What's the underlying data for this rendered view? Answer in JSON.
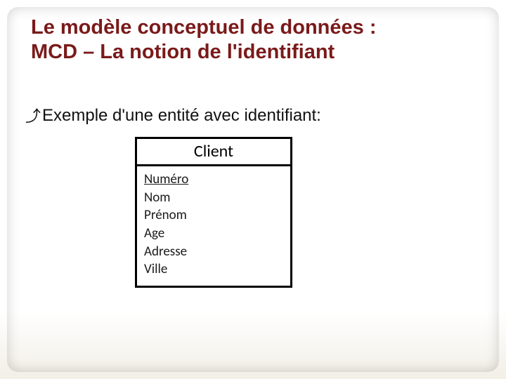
{
  "title_line1": "Le modèle conceptuel de données :",
  "title_line2": "MCD – La notion de l'identifiant",
  "bullet_glyph": "⤴",
  "bullet_text": "Exemple d'une entité avec identifiant:",
  "entity": {
    "name": "Client",
    "attributes": [
      "Numéro",
      "Nom",
      "Prénom",
      "Age",
      "Adresse",
      "Ville"
    ],
    "identifier_index": 0
  }
}
